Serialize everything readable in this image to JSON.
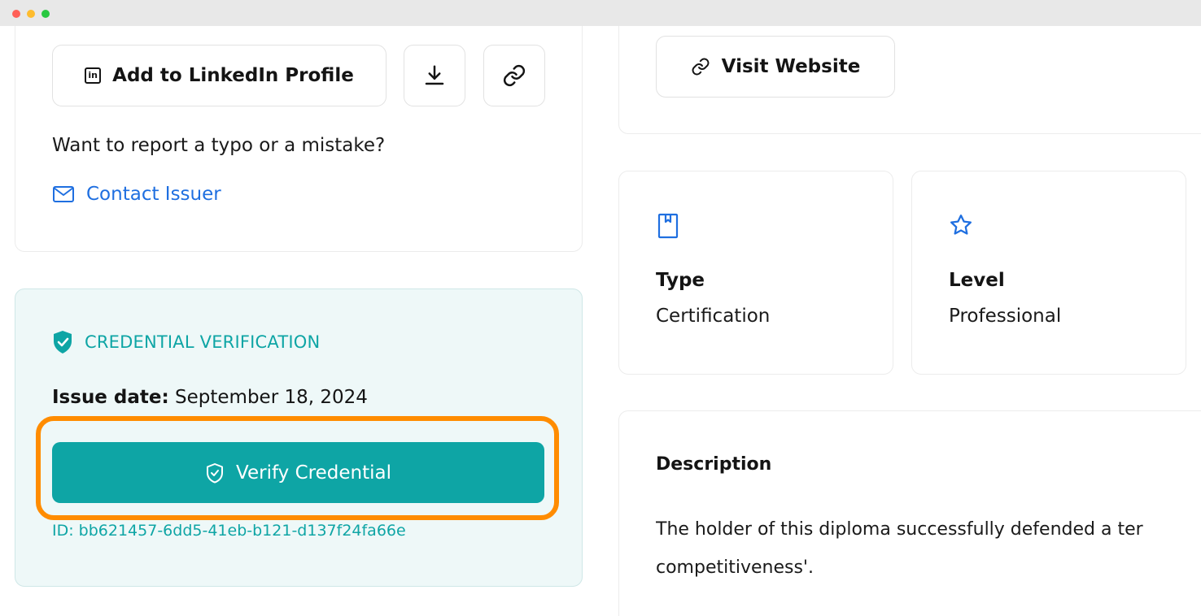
{
  "actions": {
    "linkedin_label": "Add to LinkedIn Profile",
    "linkedin_icon": "linkedin-icon",
    "download_icon": "download-icon",
    "copy_link_icon": "link-icon",
    "report_prompt": "Want to report a typo or a mistake?",
    "contact_label": "Contact Issuer",
    "contact_icon": "mail-icon"
  },
  "verification": {
    "heading": "CREDENTIAL VERIFICATION",
    "issue_date_label": "Issue date:",
    "issue_date_value": "September 18, 2024",
    "verify_label": "Verify Credential",
    "id_text": "ID: bb621457-6dd5-41eb-b121-d137f24fa66e"
  },
  "website": {
    "label": "Visit Website",
    "icon": "link-icon"
  },
  "attributes": {
    "type_label": "Type",
    "type_value": "Certification",
    "type_icon": "bookmark-icon",
    "level_label": "Level",
    "level_value": "Professional",
    "level_icon": "star-icon"
  },
  "description": {
    "title": "Description",
    "line1": "The holder of this diploma successfully defended a ter",
    "line2": "competitiveness'."
  },
  "colors": {
    "accent_teal": "#0ea5a5",
    "link_blue": "#1f6fe0",
    "highlight_orange": "#ff8c00"
  }
}
